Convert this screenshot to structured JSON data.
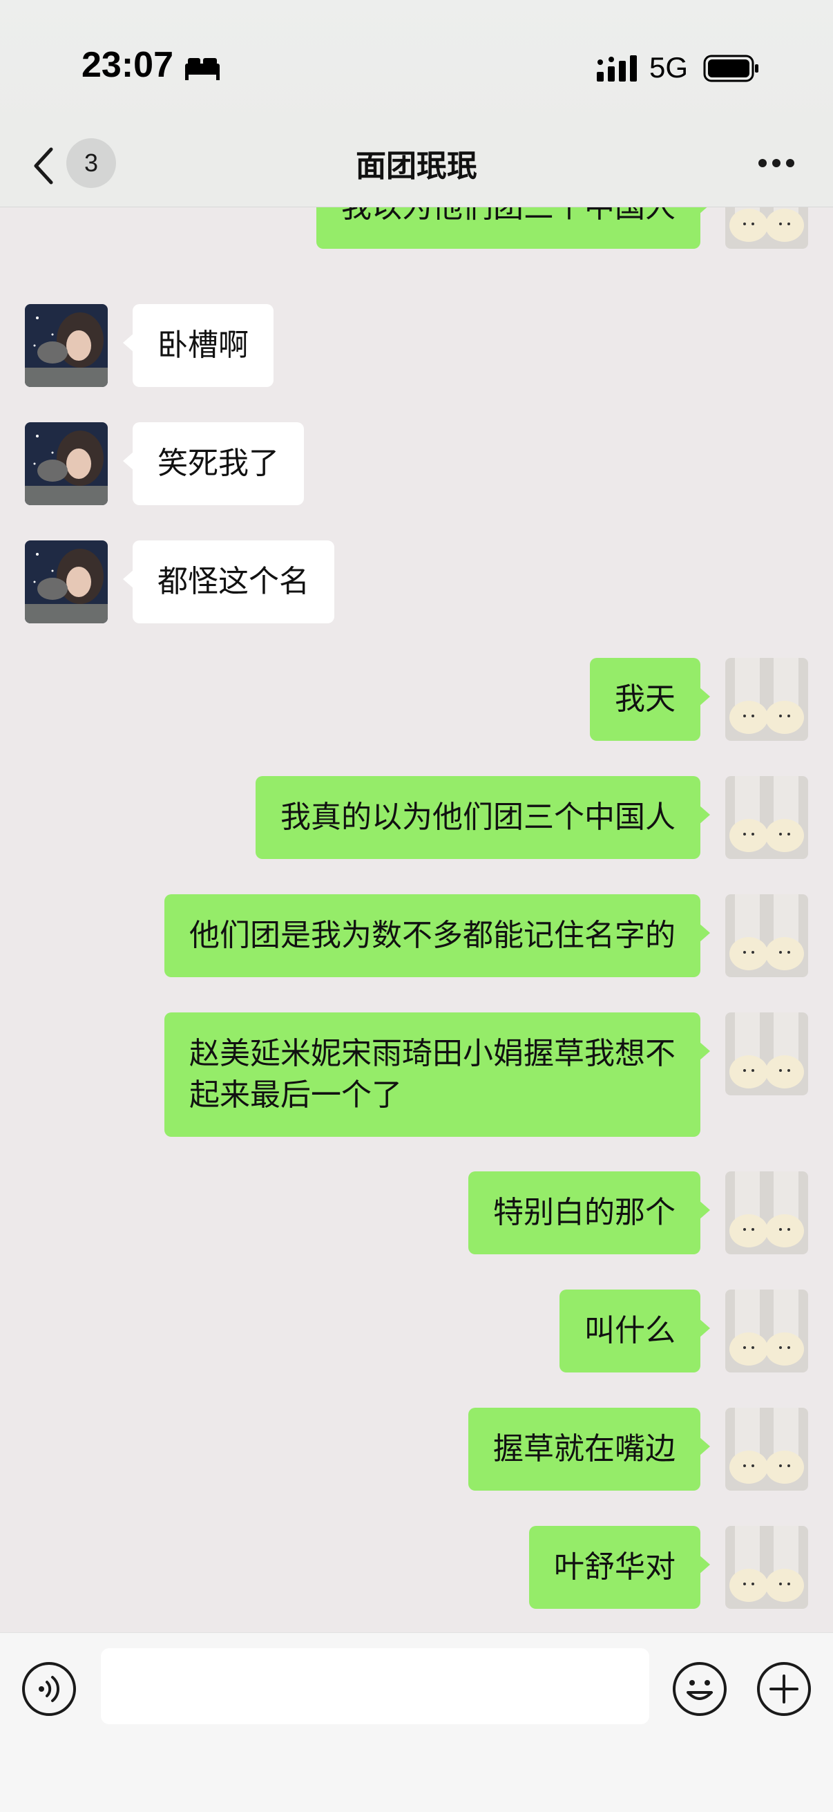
{
  "status_bar": {
    "time": "23:07",
    "network": "5G",
    "icons": [
      "bed-icon",
      "signal-icon",
      "battery-icon"
    ]
  },
  "nav": {
    "back_icon": "chevron-left-icon",
    "unread_count": "3",
    "title": "面团珉珉",
    "more_icon": "more-dots-icon"
  },
  "colors": {
    "background": "#ede9ea",
    "outgoing_bubble": "#95ec69",
    "incoming_bubble": "#ffffff"
  },
  "messages": [
    {
      "sender": "me",
      "text": "我以为他们团三个中国人"
    },
    {
      "sender": "other",
      "text": "卧槽啊"
    },
    {
      "sender": "other",
      "text": "笑死我了"
    },
    {
      "sender": "other",
      "text": "都怪这个名"
    },
    {
      "sender": "me",
      "text": "我天"
    },
    {
      "sender": "me",
      "text": "我真的以为他们团三个中国人"
    },
    {
      "sender": "me",
      "text": "他们团是我为数不多都能记住名字的"
    },
    {
      "sender": "me",
      "text": "赵美延米妮宋雨琦田小娟握草我想不\n起来最后一个了"
    },
    {
      "sender": "me",
      "text": "特别白的那个"
    },
    {
      "sender": "me",
      "text": "叫什么"
    },
    {
      "sender": "me",
      "text": "握草就在嘴边"
    },
    {
      "sender": "me",
      "text": "叶舒华对"
    }
  ],
  "input_bar": {
    "message_value": "",
    "icons": [
      "voice-icon",
      "emoji-icon",
      "plus-icon"
    ]
  }
}
